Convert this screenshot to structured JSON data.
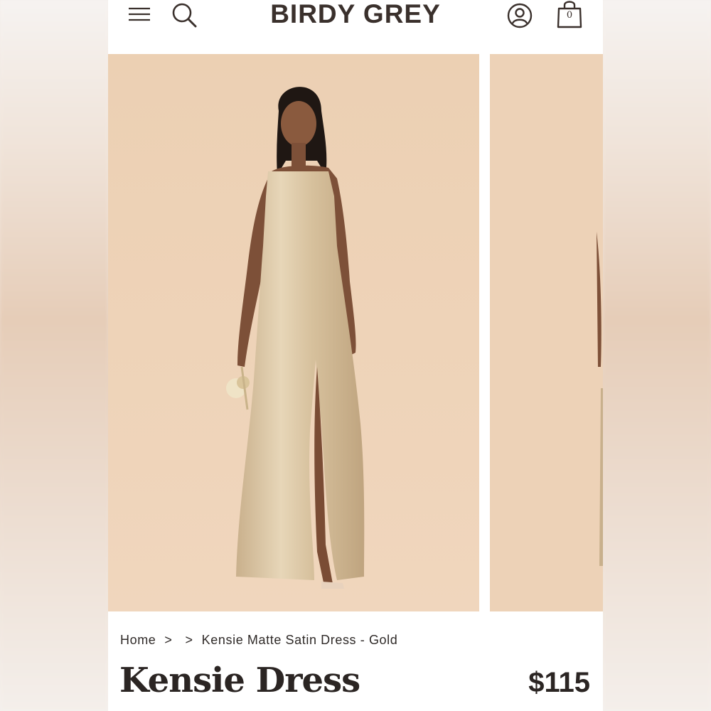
{
  "header": {
    "logo": "BIRDY GREY",
    "icons": [
      "menu-icon",
      "search-icon",
      "account-icon",
      "shopping-bag-icon"
    ],
    "bag_count": "0"
  },
  "gallery": {
    "images": [
      "dress-model-photo",
      "dress-model-photo-next"
    ],
    "background_color": "#ecd1b5",
    "dress_color": "#d8c3a1"
  },
  "breadcrumb": {
    "home": "Home",
    "separator": ">",
    "current": "Kensie Matte Satin Dress - Gold"
  },
  "product": {
    "title": "Kensie Dress",
    "price": "$115"
  },
  "colors": {
    "text_dark": "#2b2523",
    "page_bg": "#ffffff"
  }
}
